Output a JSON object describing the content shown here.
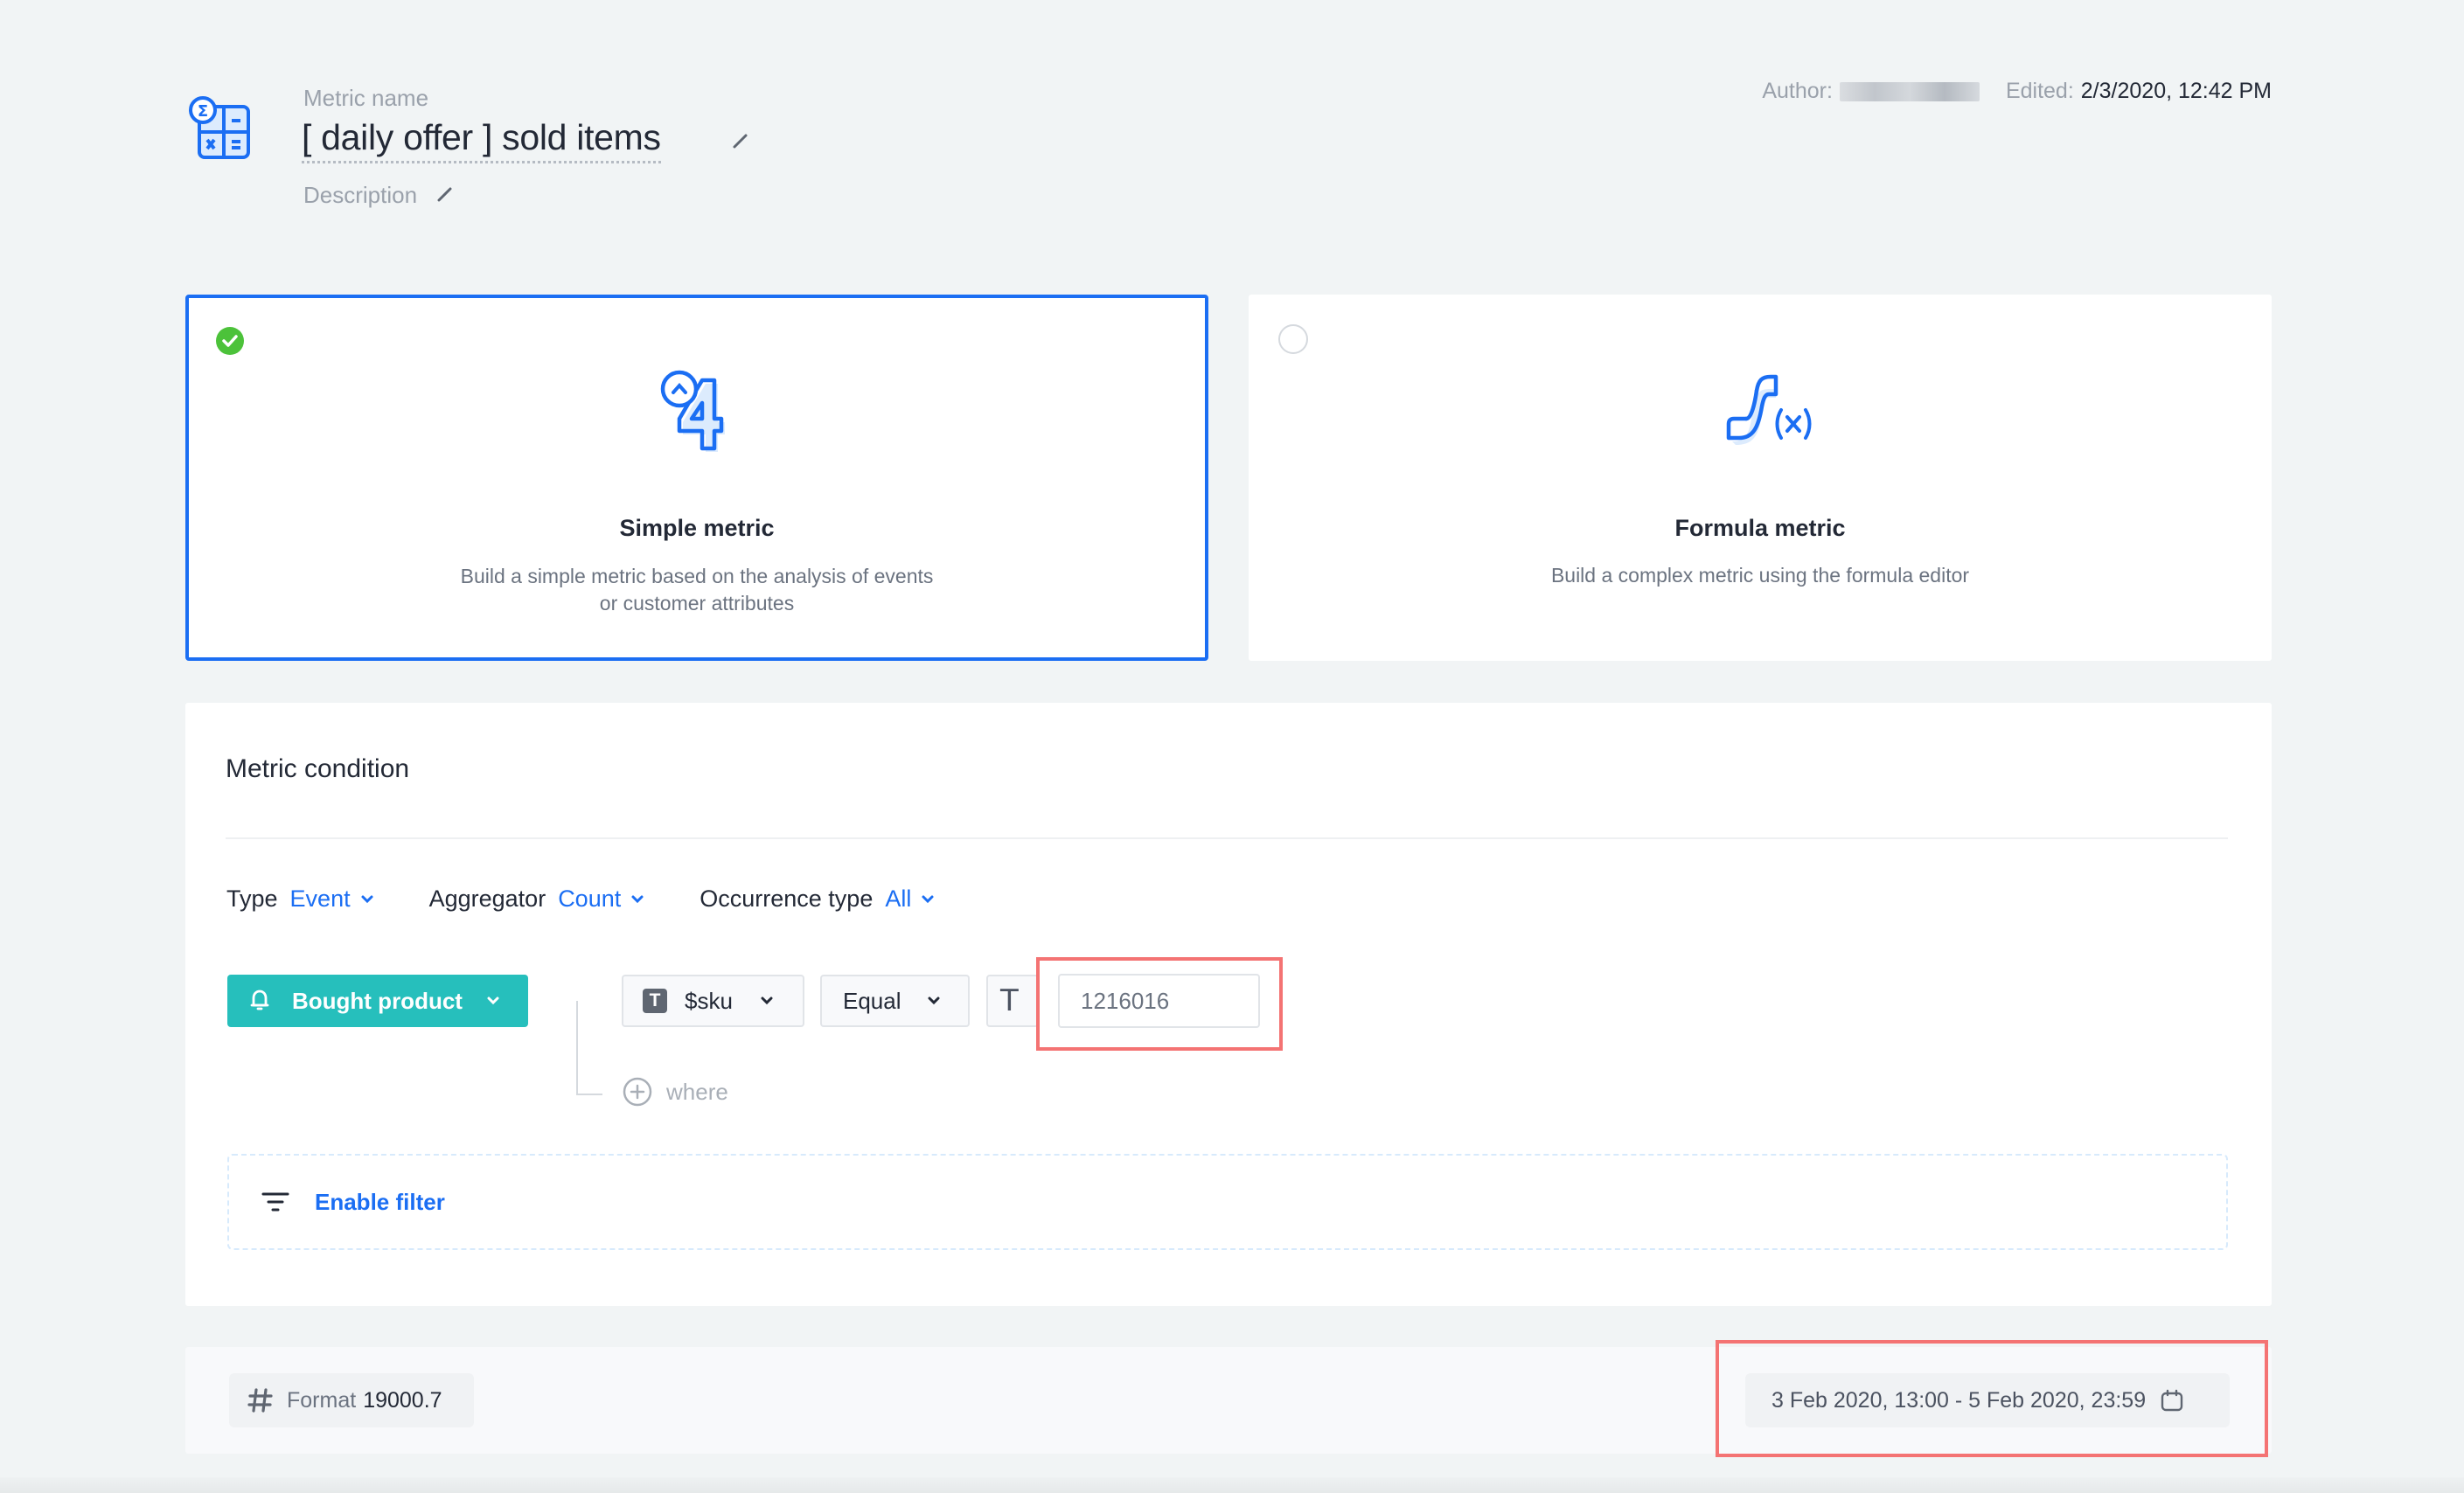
{
  "header": {
    "metric_name_label": "Metric name",
    "metric_name": "[ daily offer ] sold items",
    "description_label": "Description",
    "author_label": "Author:",
    "edited_label": "Edited:",
    "edited_value": "2/3/2020, 12:42 PM"
  },
  "metric_types": [
    {
      "id": "simple",
      "title": "Simple metric",
      "description": "Build a simple metric based on the analysis of events or customer attributes",
      "selected": true,
      "icon": "simple-metric-icon"
    },
    {
      "id": "formula",
      "title": "Formula metric",
      "description": "Build a complex metric using the formula editor",
      "selected": false,
      "icon": "formula-metric-icon"
    }
  ],
  "condition": {
    "title": "Metric condition",
    "type_label": "Type",
    "type_value": "Event",
    "aggregator_label": "Aggregator",
    "aggregator_value": "Count",
    "occurrence_label": "Occurrence type",
    "occurrence_value": "All",
    "event_name": "Bought product",
    "parameter": "$sku",
    "parameter_type_glyph": "T",
    "operator": "Equal",
    "value_type_glyph": "T",
    "value": "1216016",
    "where_label": "where",
    "enable_filter_label": "Enable filter"
  },
  "footer": {
    "format_label": "Format",
    "format_value": "19000.7",
    "date_range": "3 Feb 2020, 13:00 - 5 Feb 2020, 23:59"
  },
  "colors": {
    "accent": "#1b6ef3",
    "event_button": "#26bfbc",
    "selected_check": "#4cc23a",
    "highlight": "#f47373",
    "background": "#f1f4f5"
  }
}
